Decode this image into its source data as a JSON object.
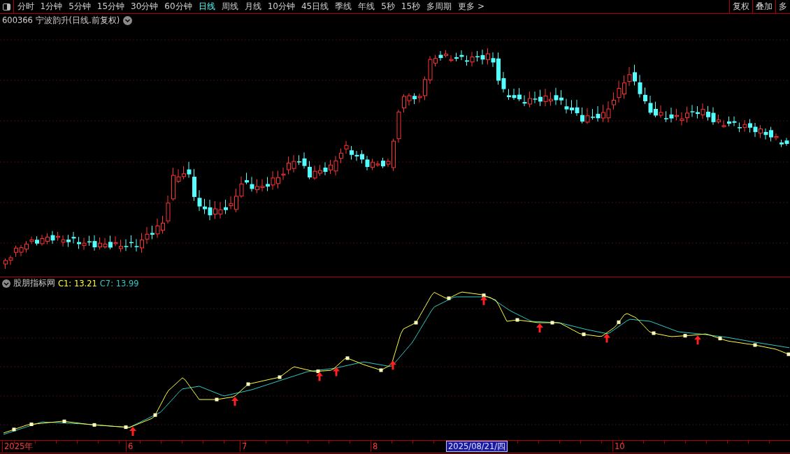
{
  "toolbar": {
    "periods": [
      {
        "label": "分时",
        "selected": false
      },
      {
        "label": "1分钟",
        "selected": false
      },
      {
        "label": "5分钟",
        "selected": false
      },
      {
        "label": "15分钟",
        "selected": false
      },
      {
        "label": "30分钟",
        "selected": false
      },
      {
        "label": "60分钟",
        "selected": false
      },
      {
        "label": "日线",
        "selected": true
      },
      {
        "label": "周线",
        "selected": false
      },
      {
        "label": "月线",
        "selected": false
      },
      {
        "label": "10分钟",
        "selected": false
      },
      {
        "label": "45日线",
        "selected": false
      },
      {
        "label": "季线",
        "selected": false
      },
      {
        "label": "年线",
        "selected": false
      },
      {
        "label": "5秒",
        "selected": false
      },
      {
        "label": "15秒",
        "selected": false
      },
      {
        "label": "多周期",
        "selected": false
      },
      {
        "label": "更多 >",
        "selected": false
      }
    ],
    "right_buttons": [
      "复权",
      "叠加",
      "多"
    ]
  },
  "chart_title": "600366 宁波韵升(日线.前复权)",
  "indicator": {
    "name": "股朋指标网",
    "c1": "C1: 13.21",
    "c7": "C7: 13.99"
  },
  "axis": {
    "labels": [
      {
        "text": "2025年",
        "selected": false
      },
      {
        "text": "6",
        "selected": false
      },
      {
        "text": "7",
        "selected": false
      },
      {
        "text": "8",
        "selected": false
      },
      {
        "text": "2025/08/21/四",
        "selected": true
      },
      {
        "text": "10",
        "selected": false
      }
    ]
  }
}
